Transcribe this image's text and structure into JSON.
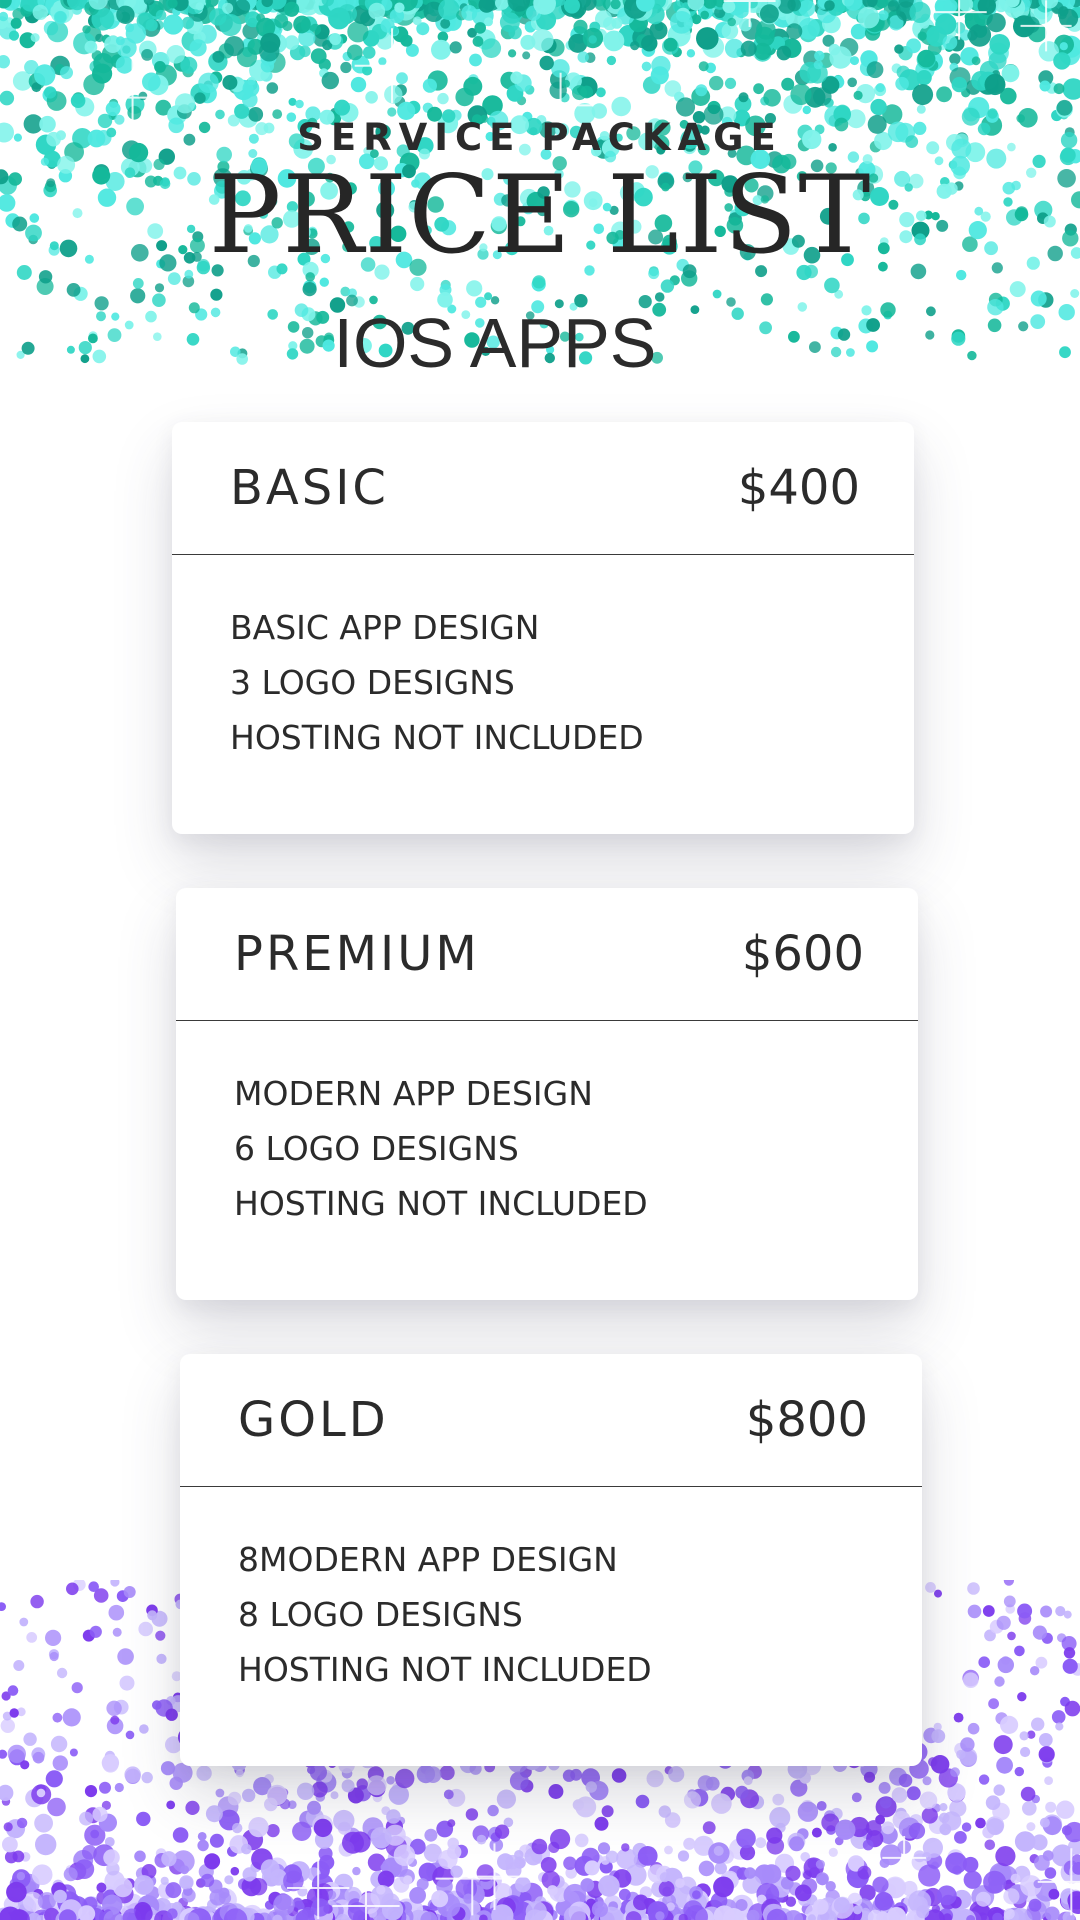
{
  "header": {
    "eyebrow": "SERVICE PACKAGE",
    "title": "PRICE LIST",
    "subtitle": "IOS APPS"
  },
  "colors": {
    "top_glitter": [
      "#14b89a",
      "#2fd6c4",
      "#4ee8e0",
      "#0e9f8a",
      "#7ff3ea"
    ],
    "bottom_glitter": [
      "#8b5cf6",
      "#a78bfa",
      "#c4b5fd",
      "#7c3aed",
      "#d8ccff"
    ],
    "text": "#2b2b2b",
    "card_background": "#ffffff"
  },
  "packages": [
    {
      "name": "BASIC",
      "price": "$400",
      "features": [
        "BASIC APP DESIGN",
        "3 LOGO DESIGNS",
        "HOSTING NOT INCLUDED"
      ]
    },
    {
      "name": "PREMIUM",
      "price": "$600",
      "features": [
        "MODERN APP DESIGN",
        "6 LOGO DESIGNS",
        "HOSTING NOT INCLUDED"
      ]
    },
    {
      "name": "GOLD",
      "price": "$800",
      "features": [
        "8MODERN APP DESIGN",
        "8 LOGO DESIGNS",
        "HOSTING NOT INCLUDED"
      ]
    }
  ]
}
